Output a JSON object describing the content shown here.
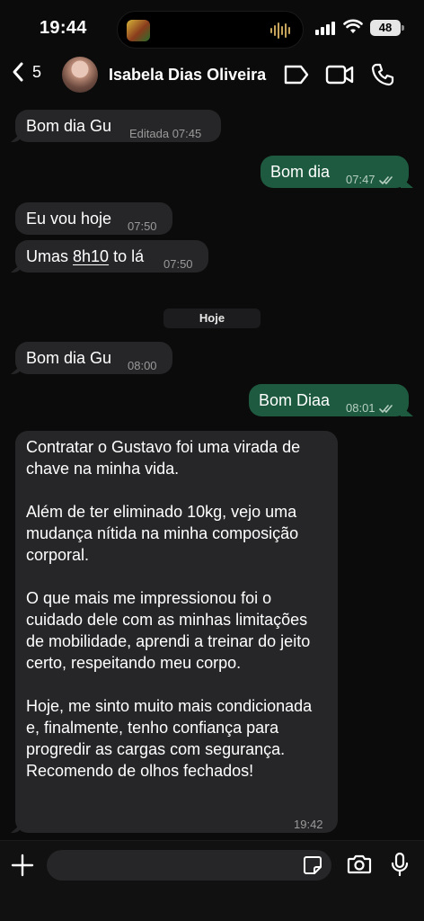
{
  "status": {
    "time": "19:44",
    "battery": "48"
  },
  "header": {
    "back_count": "5",
    "contact_name": "Isabela Dias Oliveira"
  },
  "messages": [
    {
      "dir": "in",
      "text": "Bom dia Gu",
      "meta": "Editada 07:45"
    },
    {
      "dir": "out",
      "text": "Bom dia",
      "meta": "07:47"
    },
    {
      "dir": "in",
      "text": "Eu vou hoje",
      "meta": "07:50"
    },
    {
      "dir": "in",
      "text_pre": "Umas ",
      "text_link": "8h10",
      "text_post": " to lá",
      "meta": "07:50"
    },
    {
      "dir": "in",
      "text": "Bom dia Gu",
      "meta": "08:00"
    },
    {
      "dir": "out",
      "text": "Bom Diaa",
      "meta": "08:01"
    },
    {
      "dir": "in",
      "paragraphs": [
        "Contratar o Gustavo foi uma virada de chave na minha vida.",
        "Além de ter eliminado 10kg, vejo uma mudança nítida na minha composição corporal.",
        "O que mais me impressionou foi o cuidado dele com as minhas limitações de mobilidade, aprendi a treinar do jeito certo, respeitando meu corpo.",
        "Hoje, me sinto muito mais condicionada e, finalmente, tenho confiança para progredir as cargas com segurança. Recomendo de olhos fechados!"
      ],
      "meta": "19:42"
    }
  ],
  "date_divider": "Hoje",
  "colors": {
    "incoming": "#262628",
    "outgoing": "#1d5a3f",
    "background": "#0b0b0b"
  },
  "icons": [
    "back-chevron-icon",
    "label-tag-icon",
    "video-call-icon",
    "phone-icon",
    "plus-icon",
    "sticker-icon",
    "camera-icon",
    "microphone-icon",
    "read-ticks-icon"
  ]
}
